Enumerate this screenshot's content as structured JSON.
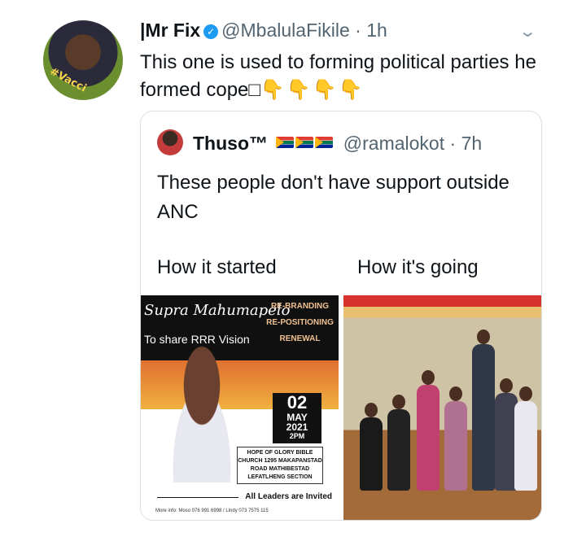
{
  "tweet": {
    "author_name": "|Mr Fix",
    "handle": "@MbalulaFikile",
    "time": "· 1h",
    "text": "This one is used to forming political parties he formed cope□",
    "emojis": "👇👇👇👇",
    "avatar_badge": "#Vacci"
  },
  "quote": {
    "author_name": "Thuso™",
    "handle": "@ramalokot",
    "time": "· 7h",
    "text": "These people don't have support outside ANC",
    "label_left": "How it started",
    "label_right": "How it's going",
    "poster": {
      "title": "Supra Mahumapelo",
      "subtitle": "To share RRR Vision",
      "rrr": [
        "RE-BRANDING",
        "RE-POSITIONING",
        "RENEWAL"
      ],
      "day": "02",
      "month": "MAY",
      "year": "2021",
      "time": "2PM",
      "venue": "HOPE OF GLORY BIBLE CHURCH 1295 MAKAPANSTAD ROAD MATHIBESTAD LEFATLHENG SECTION",
      "leaders": "All Leaders are Invited",
      "more_info": "More info: Moso 076 991 6998 / Lindy 073 7575 115"
    }
  },
  "colors": {
    "verified": "#1d9bf0",
    "text": "#0f1419",
    "muted": "#536471",
    "border": "#d9dee3"
  }
}
